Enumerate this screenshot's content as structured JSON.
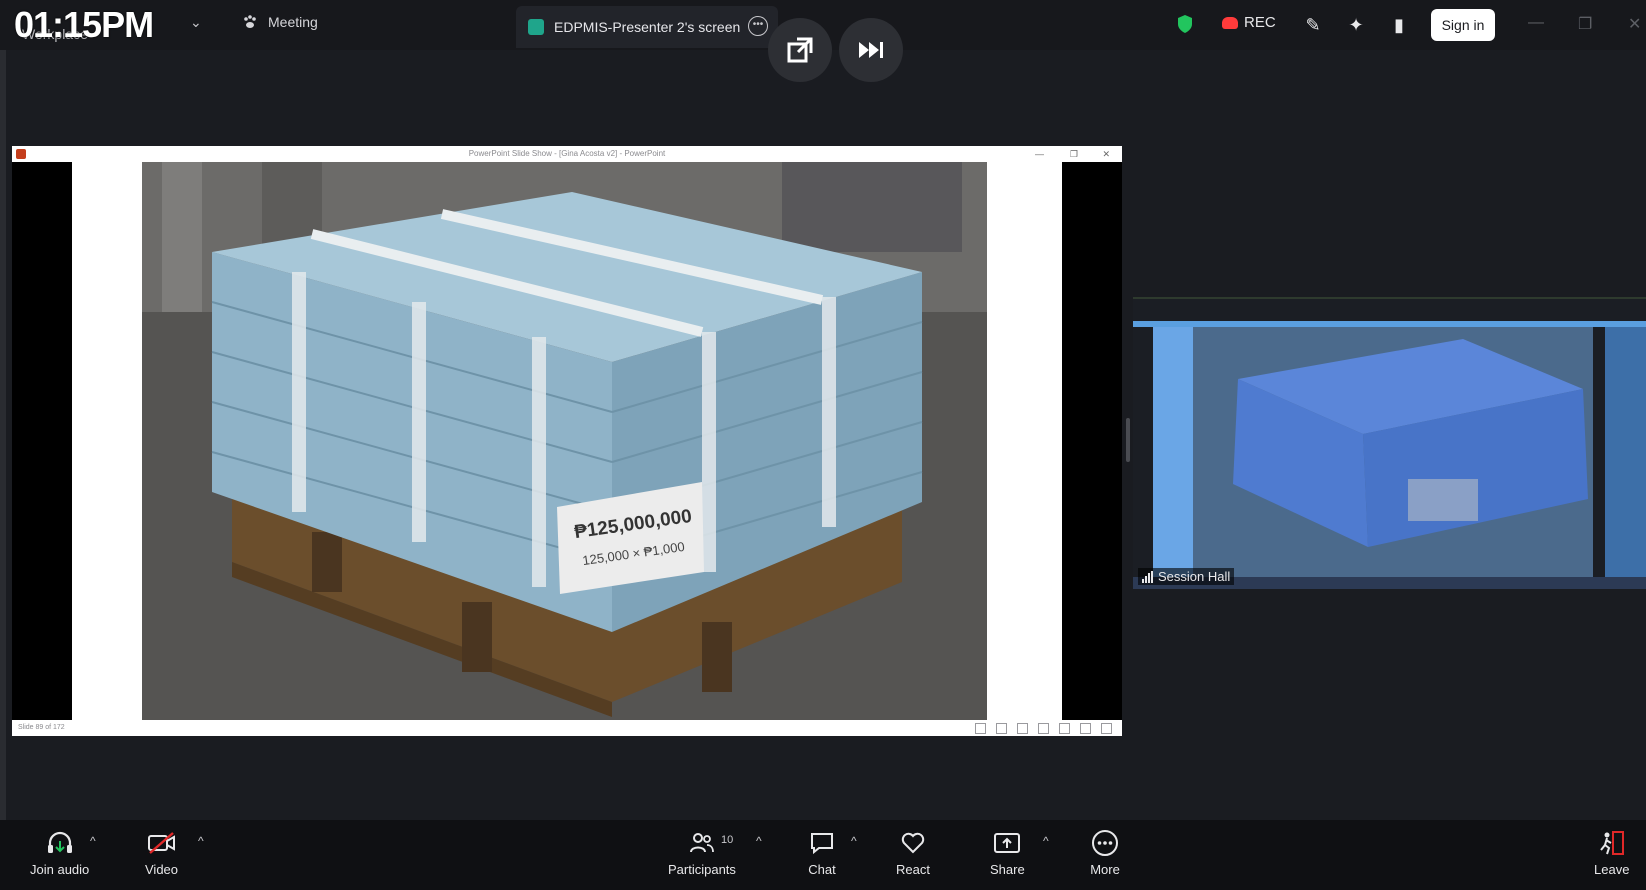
{
  "topbar": {
    "clock": "01:15PM",
    "app_subtitle": "Workplace",
    "meeting_label": "Meeting",
    "screen_tab_label": "EDPMIS-Presenter 2's screen",
    "rec_label": "REC",
    "sign_in_label": "Sign in"
  },
  "share": {
    "ppt_title": "PowerPoint Slide Show - [Gina Acosta v2] - PowerPoint",
    "slide_status": "Slide 89 of 172",
    "photo_sign_amount": "₱125,000,000",
    "photo_sign_formula": "125,000 × ₱1,000"
  },
  "thumbnail": {
    "label": "Session Hall"
  },
  "toolbar": {
    "join_audio": "Join audio",
    "video": "Video",
    "participants": "Participants",
    "participants_count": "10",
    "chat": "Chat",
    "react": "React",
    "share": "Share",
    "more": "More",
    "leave": "Leave"
  },
  "colors": {
    "accent_green": "#1fa58b",
    "shield_green": "#22c55e",
    "record_red": "#ff3b3b",
    "leave_red": "#e02828"
  }
}
